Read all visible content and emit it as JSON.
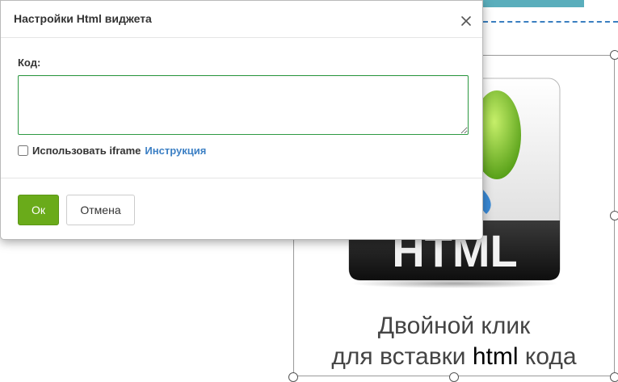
{
  "dialog": {
    "title": "Настройки Html виджета",
    "close_icon": "close-icon",
    "code_label": "Код:",
    "code_value": "",
    "code_placeholder": "",
    "iframe_checkbox_checked": false,
    "iframe_label": "Использовать iframe",
    "instruction_link": "Инструкция",
    "ok_label": "Ок",
    "cancel_label": "Отмена"
  },
  "canvas": {
    "widget": {
      "logo_text": "HTML",
      "caption_line1": "Двойной клик",
      "caption_line2_prefix": "для вставки ",
      "caption_line2_emph": "html",
      "caption_line2_suffix": " кода"
    }
  },
  "colors": {
    "ok_button": "#6aab1a",
    "link": "#3b7fc4",
    "input_focus_border": "#2e9a43",
    "top_strip": "#5aaebc"
  }
}
